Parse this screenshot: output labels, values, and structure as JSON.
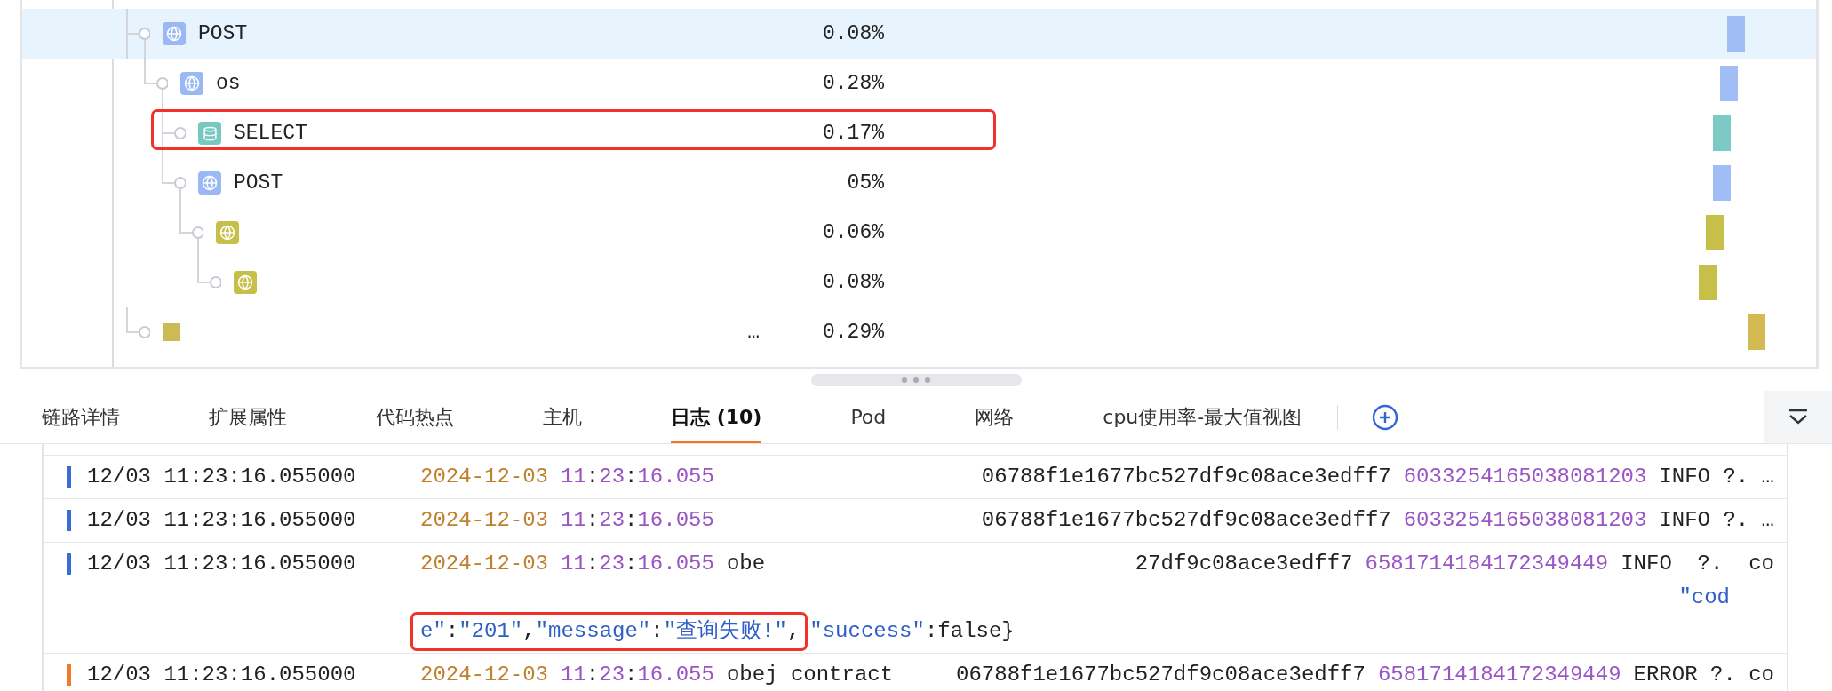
{
  "trace_tree": [
    {
      "kind": "http",
      "label": "POST",
      "duration": "0.08%",
      "selected": true,
      "highlighted": false,
      "children": [
        {
          "kind": "http",
          "label": "os",
          "duration": "0.28%",
          "selected": false,
          "highlighted": false,
          "children": [
            {
              "kind": "db",
              "label": "SELECT",
              "duration": "0.17%",
              "selected": false,
              "highlighted": true
            },
            {
              "kind": "http",
              "label": "POST",
              "duration": "05%",
              "selected": false,
              "highlighted": false,
              "children": [
                {
                  "kind": "http_alt",
                  "duration": "0.06%",
                  "selected": false,
                  "highlighted": false,
                  "children": [
                    {
                      "kind": "http_alt",
                      "duration": "0.08%",
                      "selected": false,
                      "highlighted": false
                    }
                  ]
                }
              ]
            }
          ]
        }
      ]
    },
    {
      "kind": "other",
      "label": "…",
      "duration": "0.29%",
      "selected": false,
      "highlighted": false
    }
  ],
  "tabs": [
    {
      "label": "链路详情",
      "selected": false
    },
    {
      "label": "扩展属性",
      "selected": false
    },
    {
      "label": "代码热点",
      "selected": false
    },
    {
      "label": "主机",
      "selected": false
    },
    {
      "label": "日志 (10)",
      "selected": true
    },
    {
      "label": "Pod",
      "selected": false
    },
    {
      "label": "网络",
      "selected": false
    },
    {
      "label": "cpu使用率-最大值视图",
      "selected": false
    }
  ],
  "logs": [
    {
      "kind": "info",
      "time": "12/03 11:23:16.055000",
      "date": "2024-12-03",
      "clock": "11:23:16.055",
      "trace": "06788f1e1677bc527df9c08ace3edff7",
      "span": "6033254165038081203",
      "tail": "INFO ?. …"
    },
    {
      "kind": "info",
      "time": "12/03 11:23:16.055000",
      "date": "2024-12-03",
      "clock": "11:23:16.055",
      "trace": "06788f1e1677bc527df9c08ace3edff7",
      "span": "6033254165038081203",
      "tail": "INFO ?. …"
    },
    {
      "kind": "info",
      "time": "12/03 11:23:16.055000",
      "date": "2024-12-03",
      "clock": "11:23:16.055",
      "prefix": "obe",
      "trace": "27df9c08ace3edff7",
      "span": "6581714184172349449",
      "tail": "INFO  ?.  co",
      "continued": "\"cod",
      "json_groups": [
        {
          "highlighted": true,
          "tokens": [
            {
              "kind": "string",
              "text": "e\""
            },
            {
              "kind": "punct",
              "text": ":"
            },
            {
              "kind": "string",
              "text": "\"201\""
            },
            {
              "kind": "punct",
              "text": ","
            },
            {
              "kind": "string",
              "text": "\"message\""
            },
            {
              "kind": "punct",
              "text": ":"
            },
            {
              "kind": "string",
              "text": "\"查询失败!\""
            },
            {
              "kind": "punct",
              "text": ","
            }
          ]
        },
        {
          "highlighted": false,
          "tokens": [
            {
              "kind": "string",
              "text": "\"success\""
            },
            {
              "kind": "punct",
              "text": ":false}"
            }
          ]
        }
      ]
    },
    {
      "kind": "error",
      "time": "12/03 11:23:16.055000",
      "date": "2024-12-03",
      "clock": "11:23:16.055",
      "prefix": "obej contract",
      "trace": "06788f1e1677bc527df9c08ace3edff7",
      "span": "6581714184172349449",
      "tail": "ERROR ?. co"
    }
  ]
}
